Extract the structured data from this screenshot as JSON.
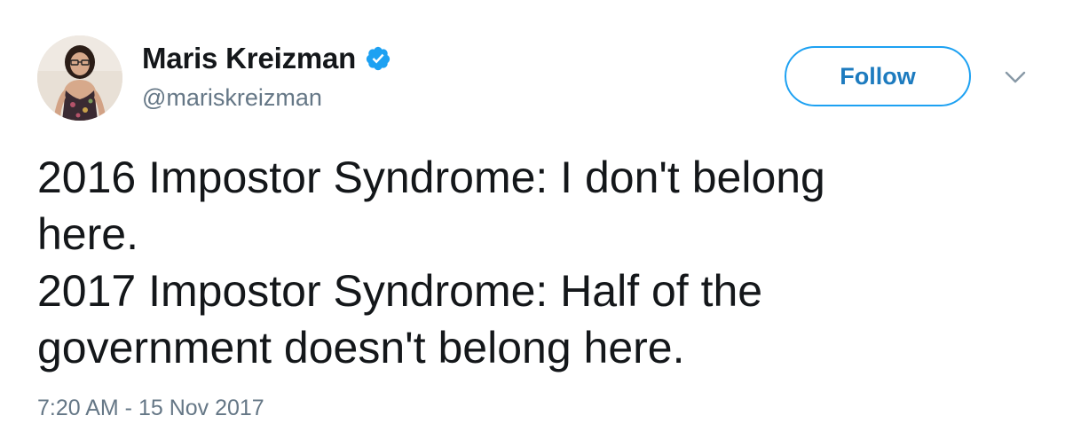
{
  "author": {
    "display_name": "Maris Kreizman",
    "handle": "@mariskreizman",
    "verified": true,
    "avatar_icon": "user-avatar-photo"
  },
  "actions": {
    "follow_label": "Follow",
    "more_icon": "chevron-down-icon"
  },
  "tweet": {
    "lines": [
      "2016 Impostor Syndrome: I don't belong",
      "here.",
      "2017 Impostor Syndrome: Half of the",
      "government doesn't belong here."
    ],
    "timestamp": "7:20 AM - 15 Nov 2017"
  },
  "colors": {
    "accent": "#1da1f2",
    "follow_text": "#1d7bbf",
    "text": "#14171a",
    "muted": "#657786"
  }
}
